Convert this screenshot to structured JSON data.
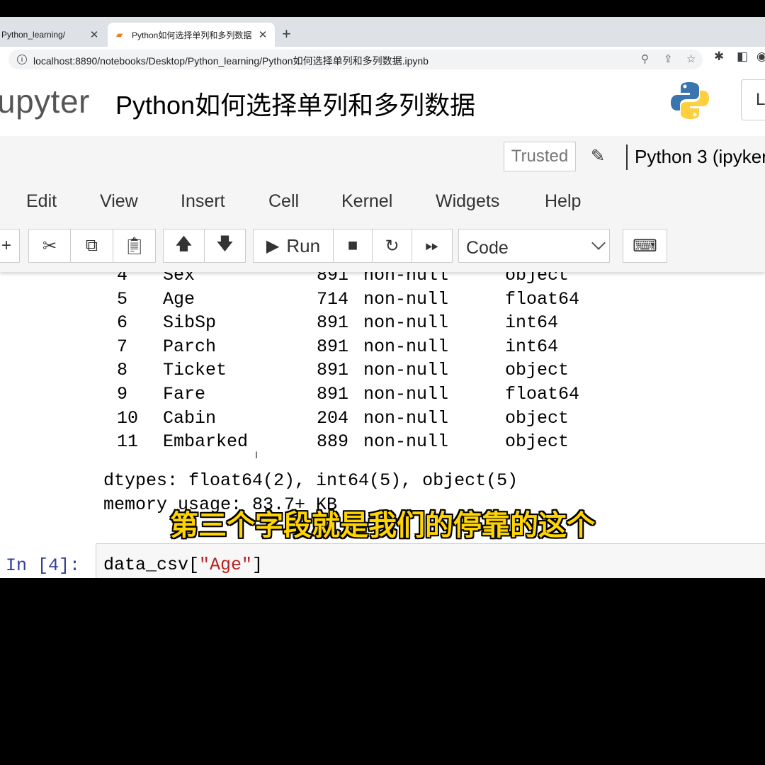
{
  "browser": {
    "tabs": [
      {
        "title": "Python_learning/",
        "active": false
      },
      {
        "title": "Python如何选择单列和多列数据",
        "active": true
      }
    ],
    "new_tab": "+",
    "url": "localhost:8890/notebooks/Desktop/Python_learning/Python如何选择单列和多列数据.ipynb"
  },
  "jupyter": {
    "logo_text": "upyter",
    "notebook_title": "Python如何选择单列和多列数据",
    "logout_label": "L",
    "trusted_label": "Trusted",
    "kernel_name": "Python 3 (ipyker",
    "menu": [
      "Edit",
      "View",
      "Insert",
      "Cell",
      "Kernel",
      "Widgets",
      "Help"
    ],
    "toolbar": {
      "run_label": "Run",
      "cell_type": "Code"
    }
  },
  "output": {
    "rows": [
      {
        "idx": "4",
        "column": "Sex",
        "count": "891",
        "nonnull": "non-null",
        "dtype": "object"
      },
      {
        "idx": "5",
        "column": "Age",
        "count": "714",
        "nonnull": "non-null",
        "dtype": "float64"
      },
      {
        "idx": "6",
        "column": "SibSp",
        "count": "891",
        "nonnull": "non-null",
        "dtype": "int64"
      },
      {
        "idx": "7",
        "column": "Parch",
        "count": "891",
        "nonnull": "non-null",
        "dtype": "int64"
      },
      {
        "idx": "8",
        "column": "Ticket",
        "count": "891",
        "nonnull": "non-null",
        "dtype": "object"
      },
      {
        "idx": "9",
        "column": "Fare",
        "count": "891",
        "nonnull": "non-null",
        "dtype": "float64"
      },
      {
        "idx": "10",
        "column": "Cabin",
        "count": "204",
        "nonnull": "non-null",
        "dtype": "object"
      },
      {
        "idx": "11",
        "column": "Embarked",
        "count": "889",
        "nonnull": "non-null",
        "dtype": "object"
      }
    ],
    "dtypes_line": "dtypes: float64(2), int64(5), object(5)",
    "memory_line": "memory usage: 83.7+ KB"
  },
  "cell": {
    "prompt": "In [4]:",
    "code_prefix": "data_csv[",
    "code_string": "\"Age\"",
    "code_suffix": "]"
  },
  "subtitle": "第三个字段就是我们的停靠的这个"
}
